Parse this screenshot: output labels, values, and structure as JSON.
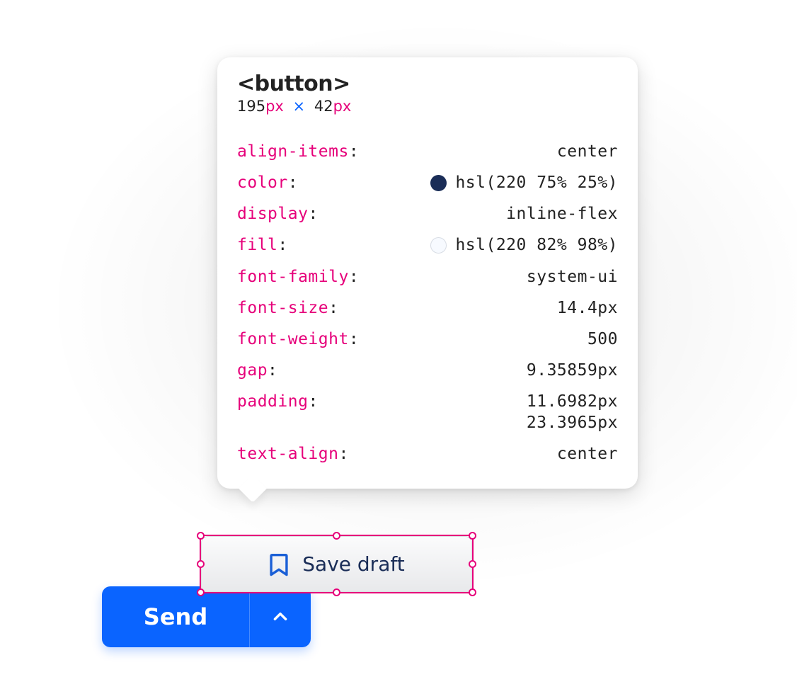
{
  "tooltip": {
    "tag": "<button>",
    "dims": {
      "w": "195",
      "unit_w": "px",
      "times": "×",
      "h": "42",
      "unit_h": "px"
    },
    "props": [
      {
        "name": "align-items",
        "value": "center"
      },
      {
        "name": "color",
        "value": "hsl(220 75% 25%)",
        "swatch": "dark"
      },
      {
        "name": "display",
        "value": "inline-flex"
      },
      {
        "name": "fill",
        "value": "hsl(220 82% 98%)",
        "swatch": "light"
      },
      {
        "name": "font-family",
        "value": "system-ui"
      },
      {
        "name": "font-size",
        "value": "14.4px"
      },
      {
        "name": "font-weight",
        "value": "500"
      },
      {
        "name": "gap",
        "value": "9.35859px"
      },
      {
        "name": "padding",
        "value": "11.6982px",
        "value2": "23.3965px"
      },
      {
        "name": "text-align",
        "value": "center"
      }
    ]
  },
  "buttons": {
    "save_draft": "Save draft",
    "send": "Send"
  }
}
